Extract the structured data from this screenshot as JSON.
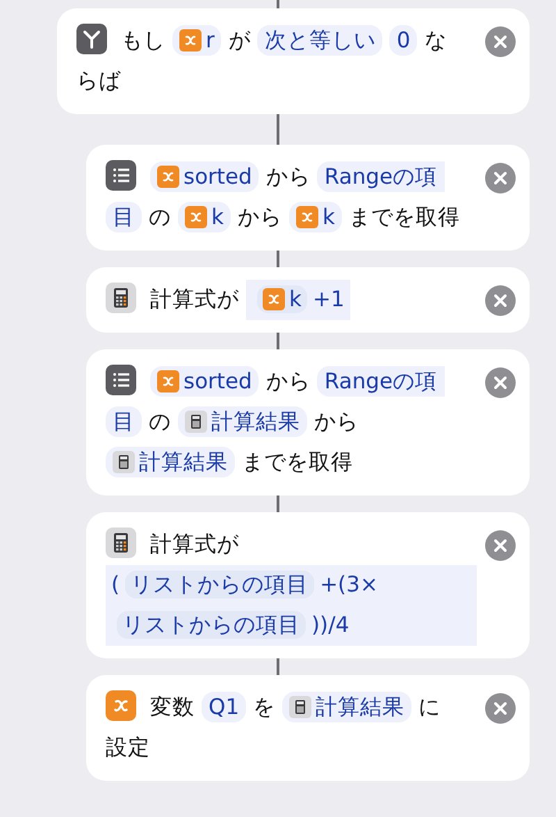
{
  "actions": [
    {
      "kind": "if",
      "tokens": [
        {
          "kind": "text",
          "text": "もし"
        },
        {
          "kind": "variable",
          "text": "r"
        },
        {
          "kind": "text",
          "text": "が"
        },
        {
          "kind": "param",
          "text": "次と等しい"
        },
        {
          "kind": "param",
          "text": "0"
        },
        {
          "kind": "text",
          "text": "な"
        },
        {
          "kind": "text",
          "text": "らば"
        }
      ],
      "children": [
        {
          "kind": "list",
          "tokens": [
            {
              "kind": "variable",
              "text": "sorted"
            },
            {
              "kind": "text",
              "text": "から"
            },
            {
              "kind": "param",
              "text": "Rangeの項",
              "continues": true
            },
            {
              "kind": "param",
              "text": "目",
              "continues": false
            },
            {
              "kind": "text",
              "text": "の"
            },
            {
              "kind": "variable",
              "text": "k"
            },
            {
              "kind": "text",
              "text": "から"
            },
            {
              "kind": "variable",
              "text": "k"
            },
            {
              "kind": "text",
              "text": "までを取得"
            }
          ]
        },
        {
          "kind": "calculator",
          "tokens": [
            {
              "kind": "text",
              "text": "計算式が"
            },
            {
              "kind": "expression",
              "parts": [
                {
                  "kind": "variable",
                  "text": "k"
                },
                {
                  "kind": "text",
                  "text": "+1"
                }
              ]
            }
          ]
        },
        {
          "kind": "list",
          "tokens": [
            {
              "kind": "variable",
              "text": "sorted"
            },
            {
              "kind": "text",
              "text": "から"
            },
            {
              "kind": "param",
              "text": "Rangeの項",
              "continues": true
            },
            {
              "kind": "param",
              "text": "目",
              "continues": false
            },
            {
              "kind": "text",
              "text": "の"
            },
            {
              "kind": "result",
              "text": "計算結果"
            },
            {
              "kind": "text",
              "text": "から"
            },
            {
              "kind": "result",
              "text": "計算結果"
            },
            {
              "kind": "text",
              "text": "までを取得"
            }
          ]
        },
        {
          "kind": "calculator",
          "tokens": [
            {
              "kind": "text",
              "text": "計算式が"
            },
            {
              "kind": "expression",
              "parts": [
                {
                  "kind": "text",
                  "text": "("
                },
                {
                  "kind": "param",
                  "text": "リストからの項目"
                },
                {
                  "kind": "text",
                  "text": "+(3×"
                },
                {
                  "kind": "param",
                  "text": "リストからの項目"
                },
                {
                  "kind": "text",
                  "text": "))/4"
                }
              ]
            }
          ]
        },
        {
          "kind": "variable",
          "tokens": [
            {
              "kind": "text",
              "text": "変数"
            },
            {
              "kind": "param",
              "text": "Q1"
            },
            {
              "kind": "text",
              "text": "を"
            },
            {
              "kind": "result",
              "text": "計算結果"
            },
            {
              "kind": "text",
              "text": "に"
            },
            {
              "kind": "text",
              "text": "設定"
            }
          ]
        }
      ]
    }
  ]
}
